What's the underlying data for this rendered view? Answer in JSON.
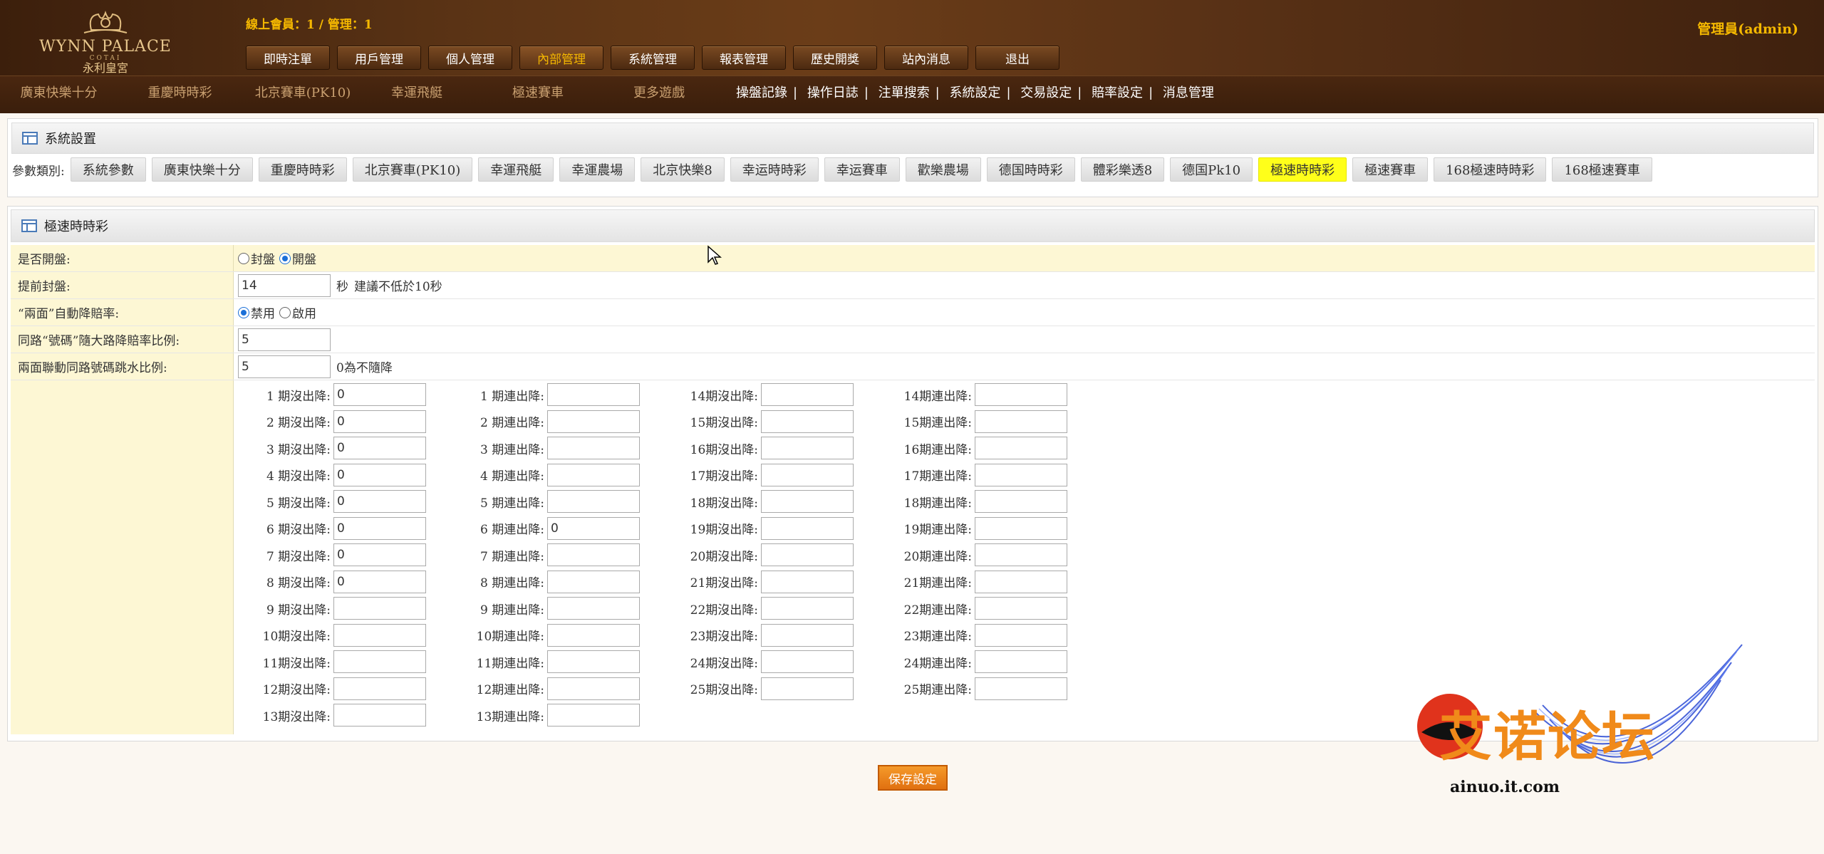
{
  "header": {
    "logo_en": "WYNN PALACE",
    "logo_sub": "COTAI",
    "logo_cn": "永利皇宮",
    "online": "線上會員：1 / 管理：1",
    "admin": "管理員(admin)",
    "nav": [
      "即時注單",
      "用戶管理",
      "個人管理",
      "內部管理",
      "系統管理",
      "報表管理",
      "歷史開獎",
      "站內消息",
      "退出"
    ],
    "nav_active": 3,
    "games": [
      "廣東快樂十分",
      "重慶時時彩",
      "北京賽車(PK10)",
      "幸運飛艇",
      "極速賽車",
      "更多遊戲"
    ],
    "links": [
      "操盤記錄",
      "操作日誌",
      "注單搜索",
      "系統設定",
      "交易設定",
      "賠率設定",
      "消息管理"
    ]
  },
  "system_panel": {
    "title": "系統設置",
    "param_label": "參數類別:",
    "params": [
      "系統參數",
      "廣東快樂十分",
      "重慶時時彩",
      "北京賽車(PK10)",
      "幸運飛艇",
      "幸運農場",
      "北京快樂8",
      "幸运時時彩",
      "幸运賽車",
      "歡樂農場",
      "德国時時彩",
      "體彩樂透8",
      "德国Pk10",
      "極速時時彩",
      "極速賽車",
      "168極速時時彩",
      "168極速賽車"
    ],
    "active_param": 13
  },
  "settings": {
    "title": "極速時時彩",
    "open": {
      "label": "是否開盤:",
      "opt1": "封盤",
      "opt2": "開盤",
      "selected": "開盤"
    },
    "early_close": {
      "label": "提前封盤:",
      "value": "14",
      "unit": "秒",
      "hint": "建議不低於10秒"
    },
    "auto_reduce": {
      "label": "“兩面”自動降賠率:",
      "opt1": "禁用",
      "opt2": "啟用",
      "selected": "禁用"
    },
    "ratio": {
      "label": "同路“號碼”隨大路降賠率比例:",
      "value": "5"
    },
    "water": {
      "label": "兩面聯動同路號碼跳水比例:",
      "value": "5",
      "hint": "0為不隨降"
    }
  },
  "periods": {
    "col1": [
      {
        "label": "1 期沒出降:",
        "value": "0"
      },
      {
        "label": "2 期沒出降:",
        "value": "0"
      },
      {
        "label": "3 期沒出降:",
        "value": "0"
      },
      {
        "label": "4 期沒出降:",
        "value": "0"
      },
      {
        "label": "5 期沒出降:",
        "value": "0"
      },
      {
        "label": "6 期沒出降:",
        "value": "0"
      },
      {
        "label": "7 期沒出降:",
        "value": "0"
      },
      {
        "label": "8 期沒出降:",
        "value": "0"
      },
      {
        "label": "9 期沒出降:",
        "value": ""
      },
      {
        "label": "10期沒出降:",
        "value": ""
      },
      {
        "label": "11期沒出降:",
        "value": ""
      },
      {
        "label": "12期沒出降:",
        "value": ""
      },
      {
        "label": "13期沒出降:",
        "value": ""
      }
    ],
    "col2": [
      {
        "label": "1 期連出降:",
        "value": ""
      },
      {
        "label": "2 期連出降:",
        "value": ""
      },
      {
        "label": "3 期連出降:",
        "value": ""
      },
      {
        "label": "4 期連出降:",
        "value": ""
      },
      {
        "label": "5 期連出降:",
        "value": ""
      },
      {
        "label": "6 期連出降:",
        "value": "0"
      },
      {
        "label": "7 期連出降:",
        "value": ""
      },
      {
        "label": "8 期連出降:",
        "value": ""
      },
      {
        "label": "9 期連出降:",
        "value": ""
      },
      {
        "label": "10期連出降:",
        "value": ""
      },
      {
        "label": "11期連出降:",
        "value": ""
      },
      {
        "label": "12期連出降:",
        "value": ""
      },
      {
        "label": "13期連出降:",
        "value": ""
      }
    ],
    "col3": [
      {
        "label": "14期沒出降:",
        "value": ""
      },
      {
        "label": "15期沒出降:",
        "value": ""
      },
      {
        "label": "16期沒出降:",
        "value": ""
      },
      {
        "label": "17期沒出降:",
        "value": ""
      },
      {
        "label": "18期沒出降:",
        "value": ""
      },
      {
        "label": "19期沒出降:",
        "value": ""
      },
      {
        "label": "20期沒出降:",
        "value": ""
      },
      {
        "label": "21期沒出降:",
        "value": ""
      },
      {
        "label": "22期沒出降:",
        "value": ""
      },
      {
        "label": "23期沒出降:",
        "value": ""
      },
      {
        "label": "24期沒出降:",
        "value": ""
      },
      {
        "label": "25期沒出降:",
        "value": ""
      }
    ],
    "col4": [
      {
        "label": "14期連出降:",
        "value": ""
      },
      {
        "label": "15期連出降:",
        "value": ""
      },
      {
        "label": "16期連出降:",
        "value": ""
      },
      {
        "label": "17期連出降:",
        "value": ""
      },
      {
        "label": "18期連出降:",
        "value": ""
      },
      {
        "label": "19期連出降:",
        "value": ""
      },
      {
        "label": "20期連出降:",
        "value": ""
      },
      {
        "label": "21期連出降:",
        "value": ""
      },
      {
        "label": "22期連出降:",
        "value": ""
      },
      {
        "label": "23期連出降:",
        "value": ""
      },
      {
        "label": "24期連出降:",
        "value": ""
      },
      {
        "label": "25期連出降:",
        "value": ""
      }
    ]
  },
  "save_label": "保存設定",
  "watermark": {
    "text": "艾诺论坛",
    "url": "ainuo.it.com"
  }
}
